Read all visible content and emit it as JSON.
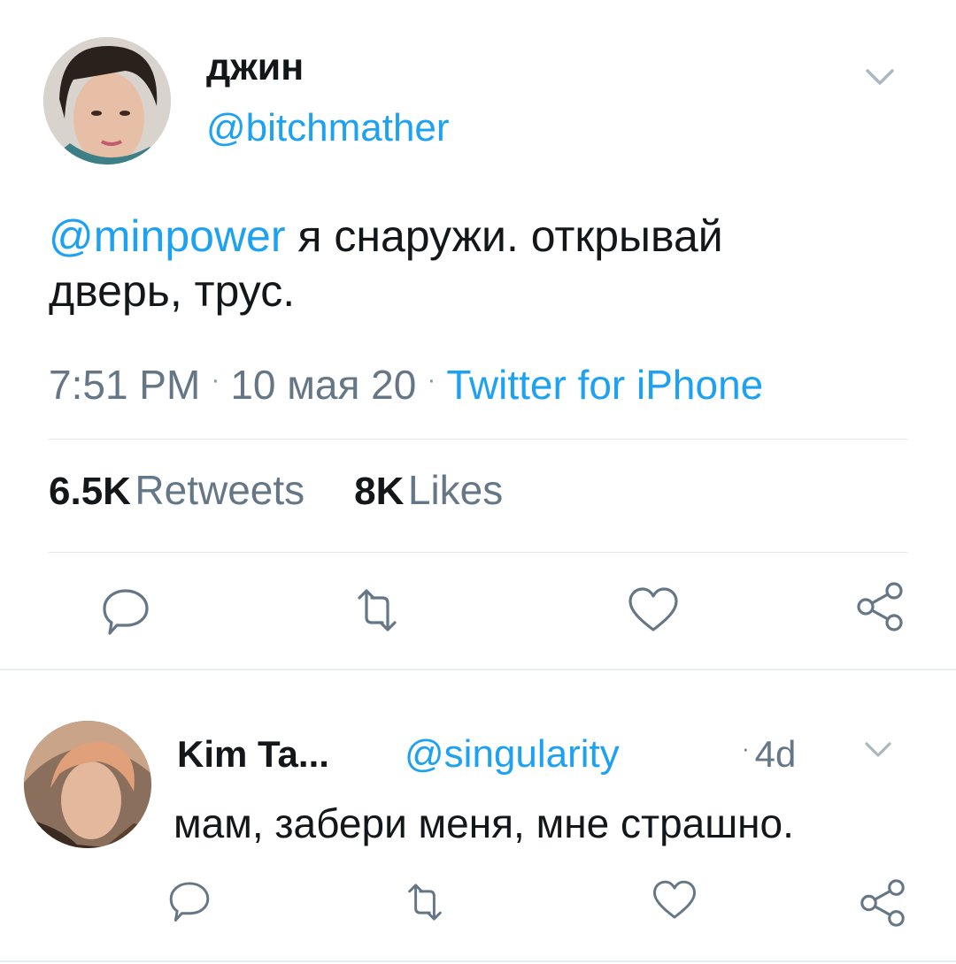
{
  "main_tweet": {
    "display_name": "джин",
    "handle": "@bitchmather",
    "text_mention": "@minpower",
    "text_body_line1": " я снаружи. открывай",
    "text_body_line2": "дверь, трус.",
    "time": "7:51 PM",
    "date": "10 мая 20",
    "source": "Twitter for iPhone",
    "separator": "·",
    "retweets_count": "6.5K",
    "retweets_label": "Retweets",
    "likes_count": "8K",
    "likes_label": "Likes",
    "actions": [
      "reply-icon",
      "retweet-icon",
      "like-icon",
      "share-icon"
    ]
  },
  "reply_tweet": {
    "display_name": "Kim Ta...",
    "handle": "@singularity",
    "separator": "·",
    "age": "4d",
    "text": "мам, забери меня, мне страшно.",
    "actions": [
      "reply-icon",
      "retweet-icon",
      "like-icon",
      "share-icon"
    ]
  },
  "colors": {
    "accent": "#1da1f2",
    "text_primary": "#14171a",
    "text_secondary": "#657786",
    "icon": "#657786",
    "divider": "#e1e8ed"
  }
}
